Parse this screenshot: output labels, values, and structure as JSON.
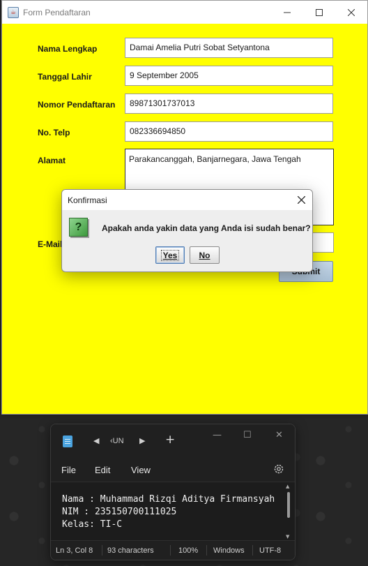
{
  "form_window": {
    "title": "Form Pendaftaran",
    "background": "#ffff00",
    "fields": [
      {
        "label": "Nama Lengkap",
        "value": "Damai Amelia Putri Sobat Setyantona"
      },
      {
        "label": "Tanggal Lahir",
        "value": "9 September 2005"
      },
      {
        "label": "Nomor Pendaftaran",
        "value": "89871301737013"
      },
      {
        "label": "No. Telp",
        "value": "082336694850"
      }
    ],
    "address": {
      "label": "Alamat",
      "value": "Parakancanggah, Banjarnegara, Jawa Tengah"
    },
    "email": {
      "label": "E-Mail",
      "value": ""
    },
    "submit_label": "Submit"
  },
  "dialog": {
    "title": "Konfirmasi",
    "message": "Apakah anda yakin data yang Anda isi sudah benar?",
    "icon": "question-icon",
    "yes_label": "Yes",
    "no_label": "No"
  },
  "notepad": {
    "tab_label": "‹UN",
    "menu": [
      "File",
      "Edit",
      "View"
    ],
    "lines": [
      "Nama : Muhammad Rizqi Aditya Firmansyah",
      "NIM : 235150700111025",
      "Kelas: TI-C"
    ],
    "status": {
      "position": "Ln 3, Col 8",
      "characters": "93 characters",
      "zoom": "100%",
      "line_ending": "Windows",
      "encoding": "UTF-8"
    }
  }
}
